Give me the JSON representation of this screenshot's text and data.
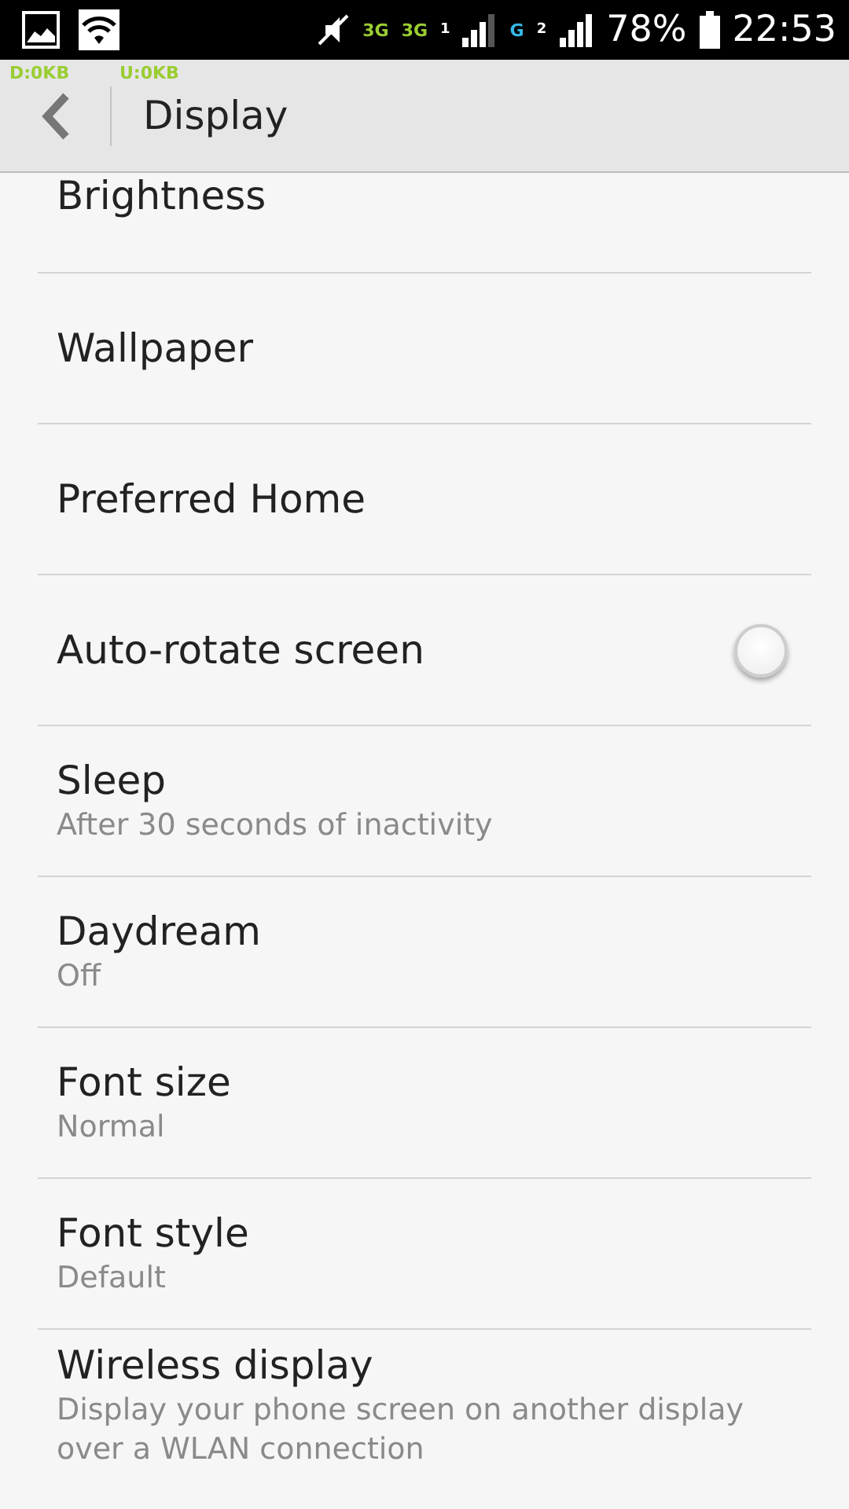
{
  "status_bar": {
    "network_1": "3G",
    "network_2": "3G",
    "sim_1": "1",
    "network_3": "G",
    "sim_2": "2",
    "battery": "78%",
    "time": "22:53"
  },
  "traffic": {
    "download": "D:0KB",
    "upload": "U:0KB"
  },
  "header": {
    "title": "Display"
  },
  "settings": [
    {
      "kind": "plain",
      "title": "Brightness"
    },
    {
      "kind": "plain",
      "title": "Wallpaper"
    },
    {
      "kind": "plain",
      "title": "Preferred Home"
    },
    {
      "kind": "switch",
      "title": "Auto-rotate screen",
      "on": false
    },
    {
      "kind": "plain",
      "title": "Sleep",
      "summary": "After 30 seconds of inactivity"
    },
    {
      "kind": "plain",
      "title": "Daydream",
      "summary": "Off"
    },
    {
      "kind": "plain",
      "title": "Font size",
      "summary": "Normal"
    },
    {
      "kind": "plain",
      "title": "Font style",
      "summary": "Default"
    },
    {
      "kind": "plain",
      "title": "Wireless display",
      "summary": "Display your phone screen on another display over a WLAN connection"
    }
  ]
}
